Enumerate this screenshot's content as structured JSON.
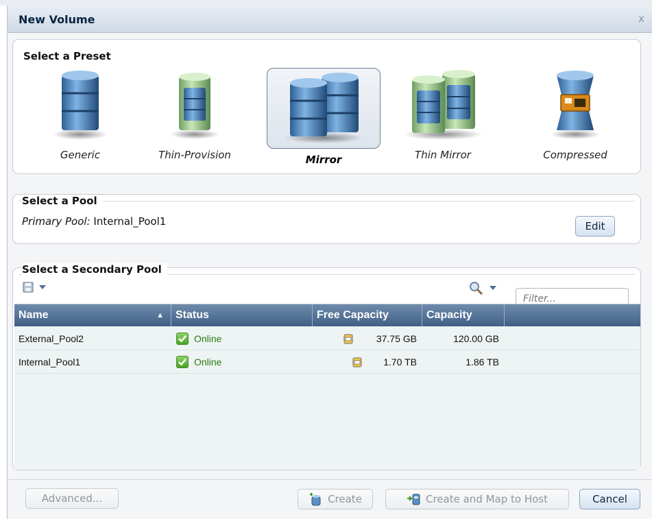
{
  "dialog": {
    "title": "New Volume",
    "close_glyph": "x"
  },
  "presets": {
    "title": "Select a Preset",
    "selected": "Mirror",
    "items": [
      {
        "label": "Generic",
        "icon": "generic-volume-icon"
      },
      {
        "label": "Thin-Provision",
        "icon": "thin-provision-volume-icon"
      },
      {
        "label": "Mirror",
        "icon": "mirror-volume-icon"
      },
      {
        "label": "Thin Mirror",
        "icon": "thin-mirror-volume-icon"
      },
      {
        "label": "Compressed",
        "icon": "compressed-volume-icon"
      }
    ]
  },
  "pool": {
    "title": "Select a Pool",
    "primary_label": "Primary Pool:",
    "primary_value": "Internal_Pool1",
    "edit_label": "Edit"
  },
  "secondary": {
    "title": "Select a Secondary Pool",
    "filter_placeholder": "Filter...",
    "columns": [
      "Name",
      "Status",
      "Free Capacity",
      "Capacity"
    ],
    "rows": [
      {
        "name": "External_Pool2",
        "status": "Online",
        "free": "37.75 GB",
        "capacity": "120.00 GB"
      },
      {
        "name": "Internal_Pool1",
        "status": "Online",
        "free": "1.70 TB",
        "capacity": "1.86 TB"
      }
    ]
  },
  "footer": {
    "advanced_label": "Advanced...",
    "create_label": "Create",
    "create_map_label": "Create and Map to Host",
    "cancel_label": "Cancel"
  },
  "colors": {
    "header_blue": "#3f5f86",
    "online_green": "#2c7a12",
    "title_navy": "#0a2540"
  }
}
